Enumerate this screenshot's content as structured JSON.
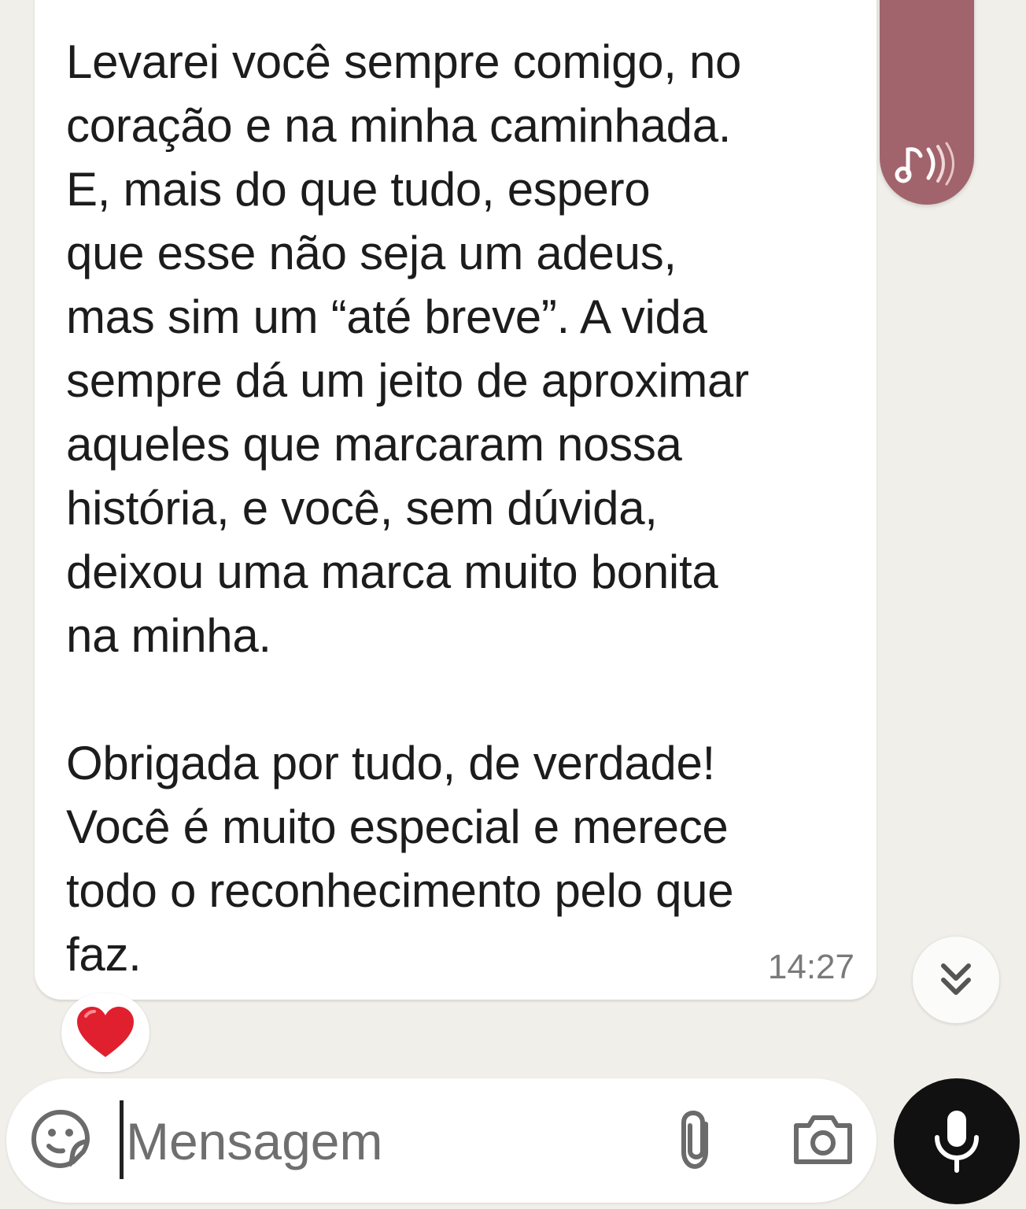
{
  "chat": {
    "message": {
      "text": "Levarei você sempre comigo, no\ncoração e na minha caminhada.\nE, mais do que tudo, espero\nque esse não seja um adeus,\nmas sim um “até breve”. A vida\nsempre dá um jeito de aproximar\naqueles que marcaram nossa\nhistória, e você, sem dúvida,\ndeixou uma marca muito bonita\nna minha.\n\nObrigada por tudo, de verdade!\nVocê é muito especial e merece\ntodo o reconhecimento pelo que\nfaz.",
      "time": "14:27",
      "reaction": "❤️"
    },
    "audio_bubble": {
      "icon": "audio-note-icon",
      "color": "#a1646c"
    }
  },
  "composer": {
    "placeholder": "Mensagem",
    "value": "",
    "icons": {
      "sticker": "sticker-icon",
      "attach": "paperclip-icon",
      "camera": "camera-icon",
      "mic": "microphone-icon"
    }
  },
  "colors": {
    "background": "#f1efea",
    "bubble": "#ffffff",
    "mic_button": "#111111"
  }
}
